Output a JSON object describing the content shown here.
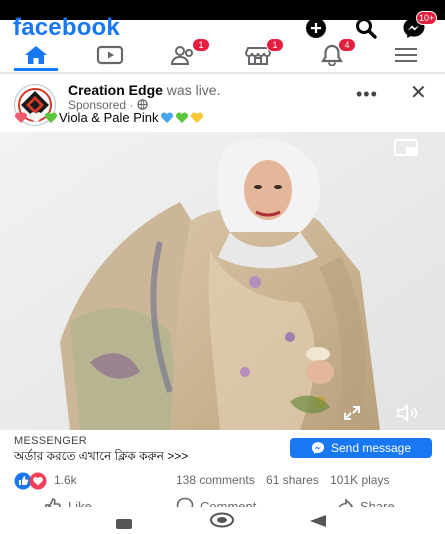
{
  "app": {
    "logo": "facebook"
  },
  "tabs": [
    {
      "name": "home",
      "badge": ""
    },
    {
      "name": "watch",
      "badge": ""
    },
    {
      "name": "friends",
      "badge": "1"
    },
    {
      "name": "marketplace",
      "badge": "1"
    },
    {
      "name": "notifications",
      "badge": "4"
    },
    {
      "name": "menu",
      "badge": ""
    }
  ],
  "top_icons": {
    "messenger_badge": "10+"
  },
  "post": {
    "page_name": "Creation Edge",
    "action_text": " was live.",
    "sponsored": "Sponsored ·",
    "caption": "Viola & Pale Pink",
    "more": "•••",
    "close": "✕"
  },
  "messenger": {
    "label": "MESSENGER",
    "text": "অর্ডার করতে এখানে ক্লিক করুন >>>",
    "button": "Send message"
  },
  "stats": {
    "reactions": "1.6k",
    "comments": "138 comments",
    "shares": "61 shares",
    "plays": "101K plays"
  },
  "actions": {
    "like": "Like",
    "comment": "Comment",
    "share": "Share"
  },
  "colors": {
    "brand": "#1877f2",
    "badge": "#e41e3f"
  }
}
